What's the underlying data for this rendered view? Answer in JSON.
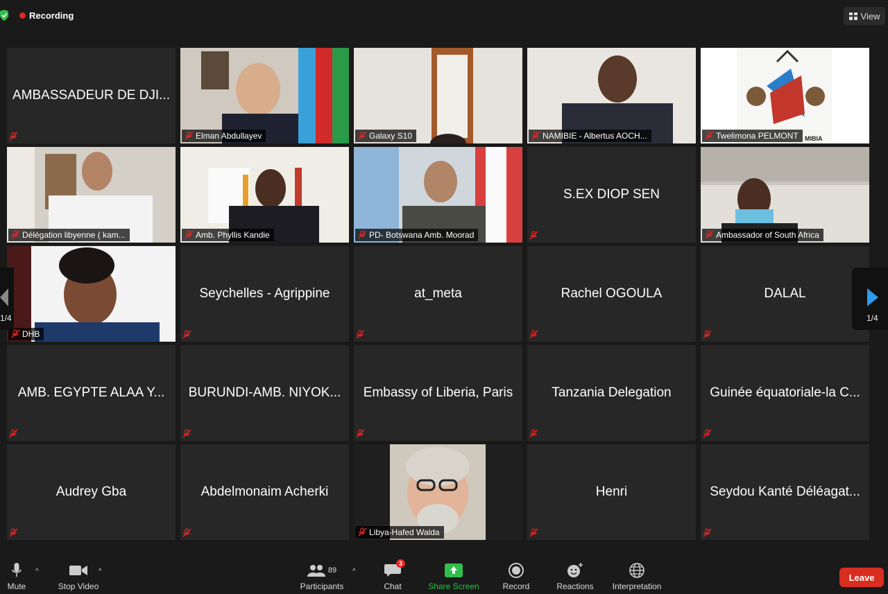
{
  "topbar": {
    "recording_label": "Recording",
    "view_label": "View"
  },
  "pagination": {
    "left_label": "1/4",
    "right_label": "1/4"
  },
  "tiles": [
    {
      "name": "AMBASSADEUR DE DJI...",
      "label": "",
      "video": false
    },
    {
      "name": "",
      "label": "Elman Abdullayev",
      "video": true
    },
    {
      "name": "",
      "label": "Galaxy S10",
      "video": true
    },
    {
      "name": "",
      "label": "NAMIBIE - Albertus AOCH...",
      "video": true,
      "active": true
    },
    {
      "name": "",
      "label": "Twelimona PELMONT",
      "video": true
    },
    {
      "name": "",
      "label": "Délégation libyenne ( kam...",
      "video": true
    },
    {
      "name": "",
      "label": "Amb. Phyllis Kandie",
      "video": true
    },
    {
      "name": "",
      "label": "PD- Botswana Amb. Moorad",
      "video": true
    },
    {
      "name": "S.EX DIOP SEN",
      "label": "",
      "video": false
    },
    {
      "name": "",
      "label": "Ambassador of South Africa",
      "video": true
    },
    {
      "name": "",
      "label": "DHB",
      "video": true
    },
    {
      "name": "Seychelles -  Agrippine",
      "label": "",
      "video": false
    },
    {
      "name": "at_meta",
      "label": "",
      "video": false
    },
    {
      "name": "Rachel OGOULA",
      "label": "",
      "video": false
    },
    {
      "name": "DALAL",
      "label": "",
      "video": false
    },
    {
      "name": "AMB. EGYPTE ALAA Y...",
      "label": "",
      "video": false
    },
    {
      "name": "BURUNDI-AMB. NIYOK...",
      "label": "",
      "video": false
    },
    {
      "name": "Embassy of Liberia, Paris",
      "label": "",
      "video": false
    },
    {
      "name": "Tanzania Delegation",
      "label": "",
      "video": false
    },
    {
      "name": "Guinée équatoriale-la C...",
      "label": "",
      "video": false
    },
    {
      "name": "Audrey Gba",
      "label": "",
      "video": false
    },
    {
      "name": "Abdelmonaim Acherki",
      "label": "",
      "video": false
    },
    {
      "name": "",
      "label": "Libya-Hafed Walda",
      "video": true
    },
    {
      "name": "Henri",
      "label": "",
      "video": false
    },
    {
      "name": "Seydou Kanté Déléagat...",
      "label": "",
      "video": false
    }
  ],
  "coat_of_arms_text": "MIBIA",
  "toolbar": {
    "mute_label": "Mute",
    "stop_video_label": "Stop Video",
    "participants_label": "Participants",
    "participants_count": "89",
    "chat_label": "Chat",
    "chat_badge": "3",
    "share_label": "Share Screen",
    "record_label": "Record",
    "reactions_label": "Reactions",
    "interpretation_label": "Interpretation",
    "leave_label": "Leave"
  },
  "colors": {
    "share_green": "#2fbf4a",
    "leave_red": "#d92d20",
    "active_border": "#d8e63a",
    "recording_red": "#e22525"
  }
}
